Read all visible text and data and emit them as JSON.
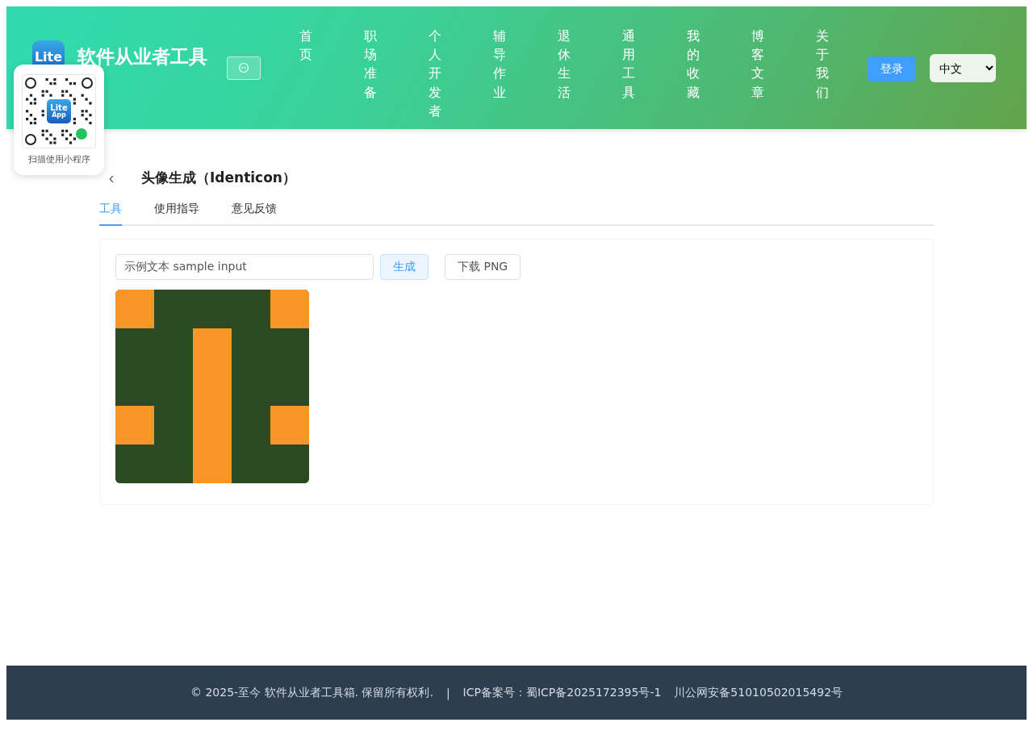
{
  "header": {
    "logo_text": "Lite",
    "site_title": "软件从业者工具",
    "nav": [
      {
        "label": "首页",
        "selected": false
      },
      {
        "label": "职场准备",
        "selected": false
      },
      {
        "label": "个人开发者",
        "selected": false
      },
      {
        "label": "辅导作业",
        "selected": false
      },
      {
        "label": "退休生活",
        "selected": false
      },
      {
        "label": "通用工具",
        "selected": false
      },
      {
        "label": "我的收藏",
        "selected": false
      },
      {
        "label": "博客文章",
        "selected": false
      },
      {
        "label": "关于我们",
        "selected": false
      }
    ],
    "login_button": "登录",
    "language": "中文"
  },
  "qr_popup": {
    "logo_line_1": "Lite",
    "logo_line_2": "App",
    "caption": "扫描使用小程序"
  },
  "page": {
    "back": "‹",
    "title": "头像生成（Identicon）",
    "tabs": [
      {
        "label": "工具",
        "selected": true
      },
      {
        "label": "使用指导",
        "selected": false
      },
      {
        "label": "意见反馈",
        "selected": false
      }
    ],
    "input": {
      "value": "示例文本 sample input"
    },
    "generate_button": "生成",
    "download_button": "下载 PNG",
    "identicon": {
      "rows": [
        [
          true,
          false,
          false,
          false,
          true
        ],
        [
          false,
          false,
          true,
          false,
          false
        ],
        [
          false,
          false,
          true,
          false,
          false
        ],
        [
          true,
          false,
          true,
          false,
          true
        ],
        [
          false,
          false,
          true,
          false,
          false
        ]
      ]
    }
  },
  "footer": {
    "copyright": "© 2025-至今 软件从业者工具箱. 保留所有权利.",
    "separator": "|",
    "icp": "ICP备案号：蜀ICP备2025172395号-1",
    "police": "川公网安备51010502015492号"
  }
}
